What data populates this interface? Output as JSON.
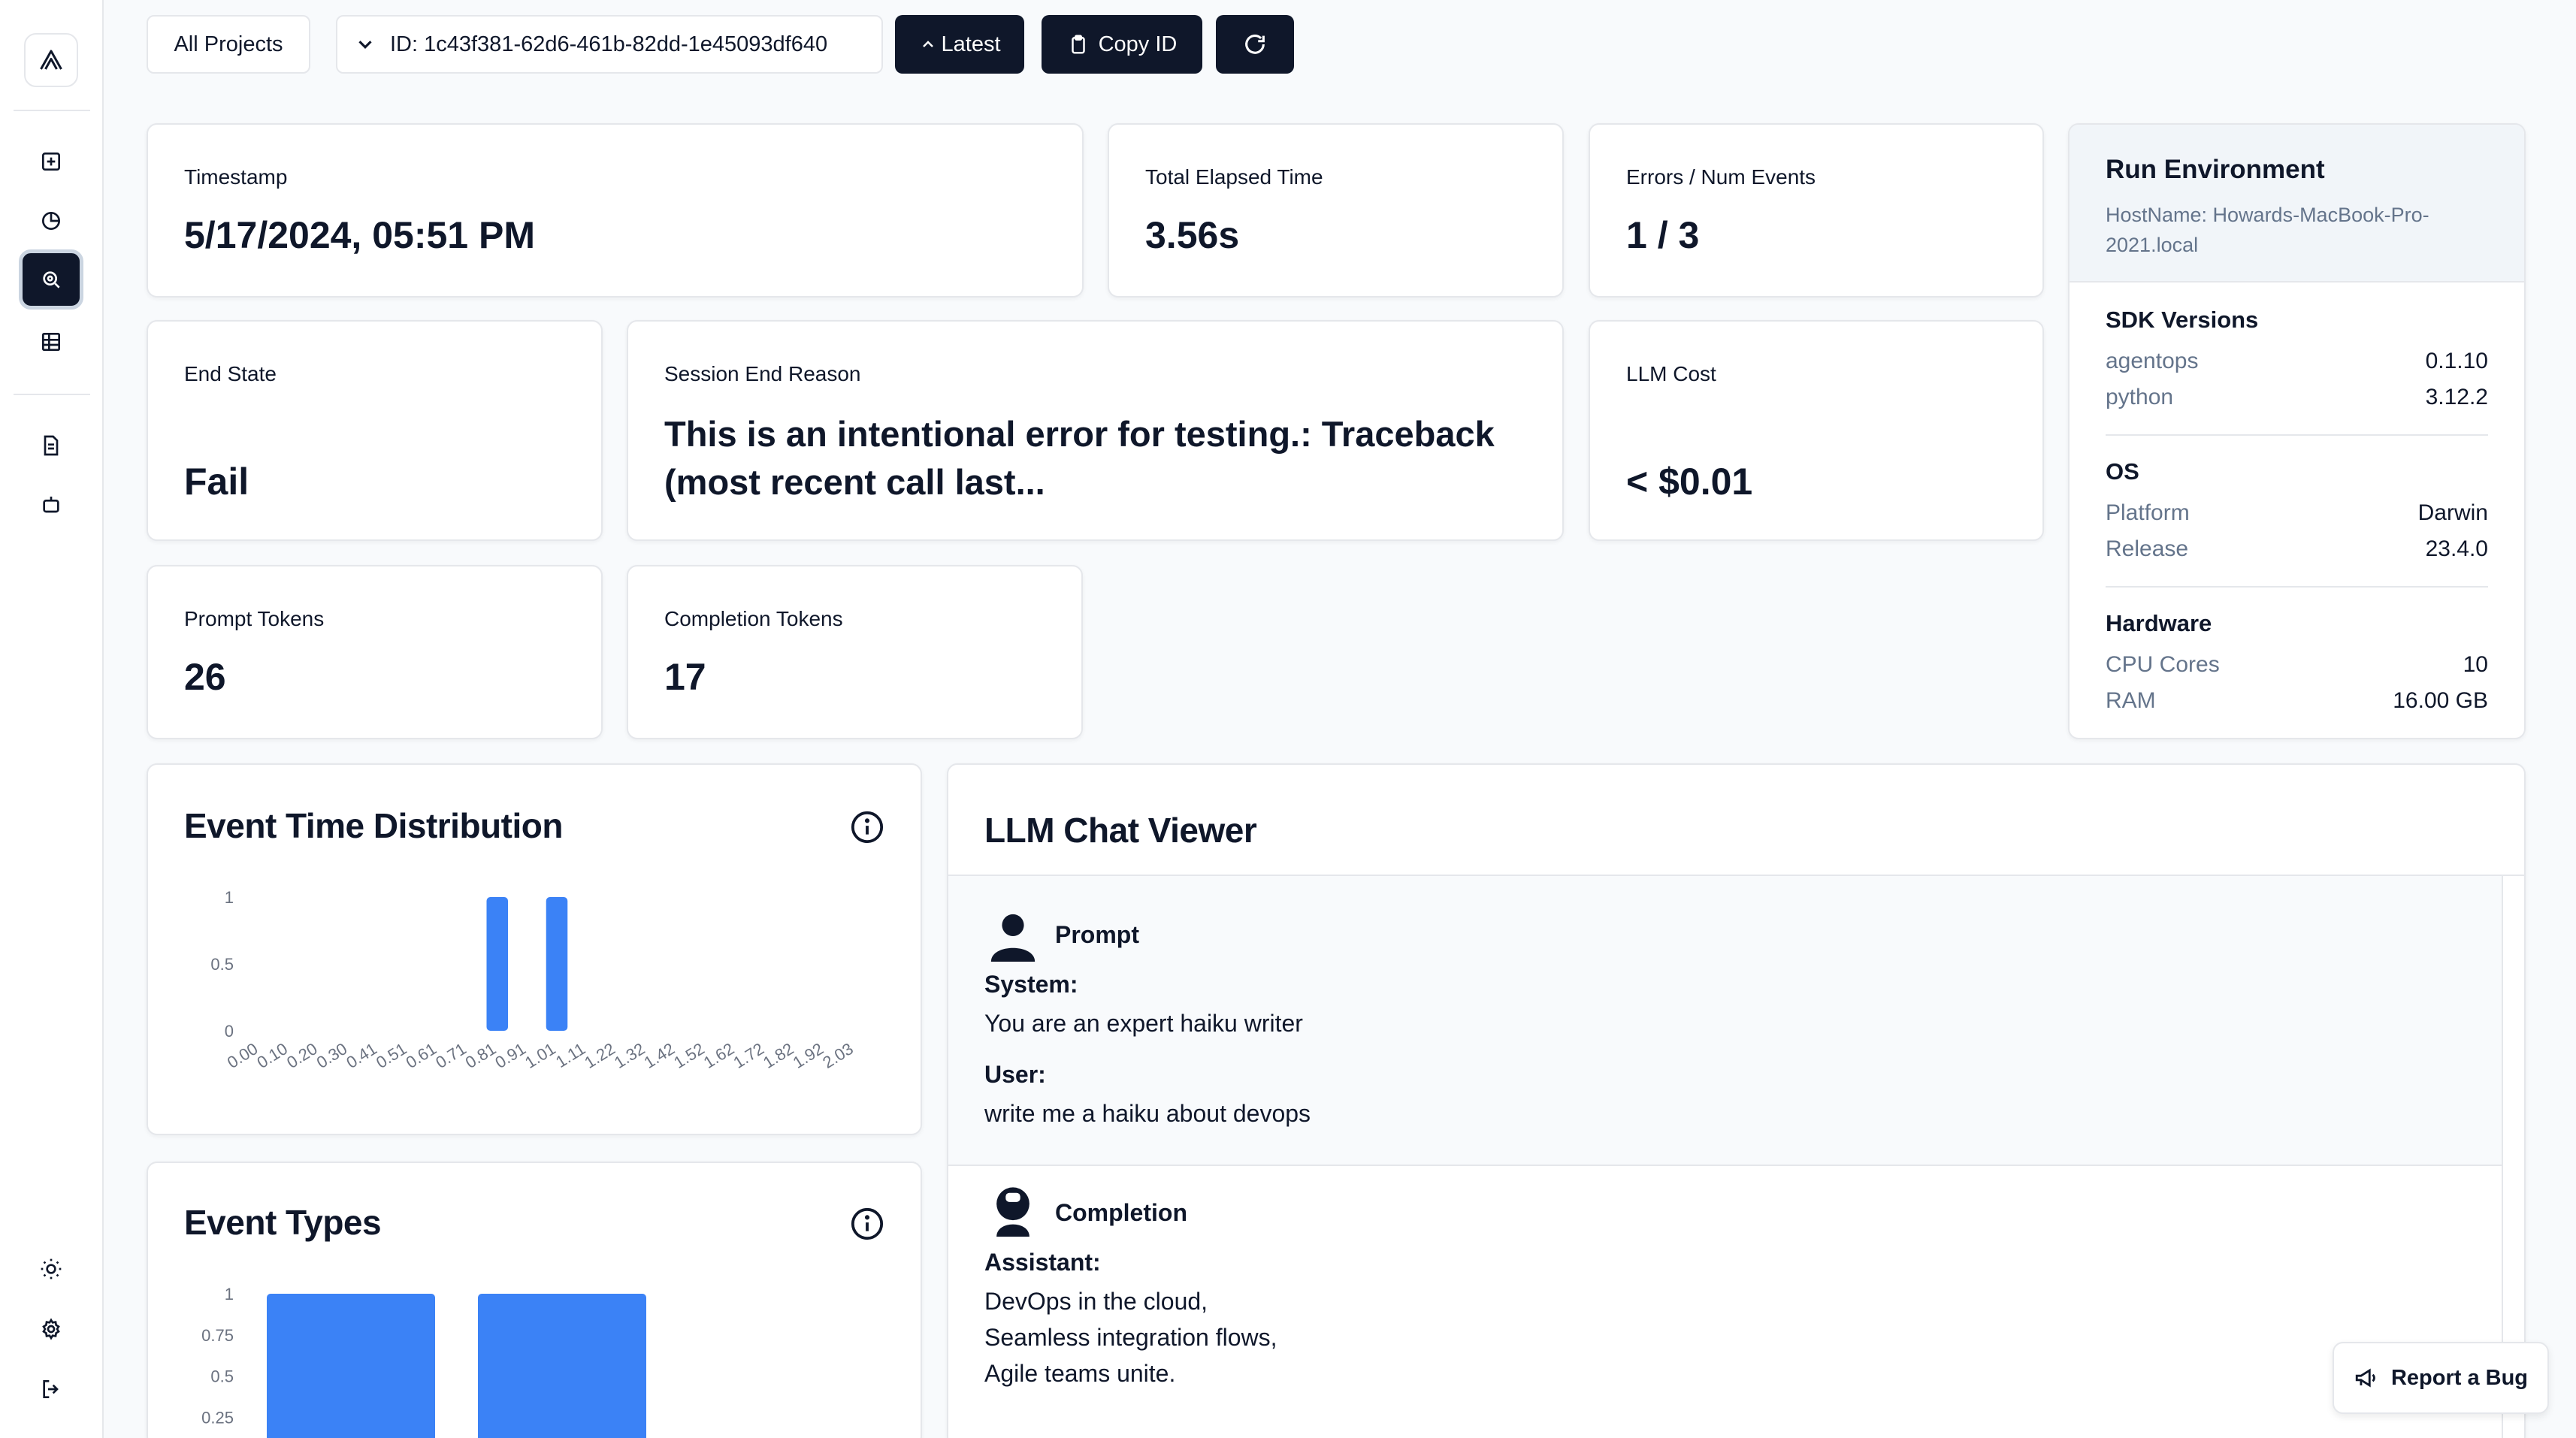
{
  "toolbar": {
    "all_projects": "All Projects",
    "session_id": "ID: 1c43f381-62d6-461b-82dd-1e45093df640",
    "latest": "Latest",
    "copy_id": "Copy ID"
  },
  "stats": {
    "timestamp_label": "Timestamp",
    "timestamp_value": "5/17/2024, 05:51 PM",
    "elapsed_label": "Total Elapsed Time",
    "elapsed_value": "3.56s",
    "errors_label": "Errors / Num Events",
    "errors_value": "1 / 3",
    "end_state_label": "End State",
    "end_state_value": "Fail",
    "end_reason_label": "Session End Reason",
    "end_reason_value": "This is an intentional error for testing.: Traceback (most recent call last...",
    "llm_cost_label": "LLM Cost",
    "llm_cost_value": "< $0.01",
    "prompt_tokens_label": "Prompt Tokens",
    "prompt_tokens_value": "26",
    "completion_tokens_label": "Completion Tokens",
    "completion_tokens_value": "17"
  },
  "env": {
    "title": "Run Environment",
    "host": "HostName: Howards-MacBook-Pro-2021.local",
    "sdk_title": "SDK Versions",
    "sdk": [
      {
        "k": "agentops",
        "v": "0.1.10"
      },
      {
        "k": "python",
        "v": "3.12.2"
      }
    ],
    "os_title": "OS",
    "os": [
      {
        "k": "Platform",
        "v": "Darwin"
      },
      {
        "k": "Release",
        "v": "23.4.0"
      }
    ],
    "hw_title": "Hardware",
    "hw": [
      {
        "k": "CPU Cores",
        "v": "10"
      },
      {
        "k": "RAM",
        "v": "16.00 GB"
      }
    ]
  },
  "event_time": {
    "title": "Event Time Distribution"
  },
  "event_types": {
    "title": "Event Types"
  },
  "chat": {
    "title": "LLM Chat Viewer",
    "prompt_label": "Prompt",
    "system_role": "System:",
    "system_msg": "You are an expert haiku writer",
    "user_role": "User:",
    "user_msg": "write me a haiku about devops",
    "completion_label": "Completion",
    "assistant_role": "Assistant:",
    "assistant_lines": [
      "DevOps in the cloud,",
      "Seamless integration flows,",
      "Agile teams unite."
    ]
  },
  "report_bug": "Report a Bug",
  "colors": {
    "bar": "#3b82f6",
    "dark": "#0f172a",
    "muted": "#64748b"
  },
  "chart_data": [
    {
      "type": "bar",
      "title": "Event Time Distribution",
      "categories": [
        "0.00",
        "0.10",
        "0.20",
        "0.30",
        "0.41",
        "0.51",
        "0.61",
        "0.71",
        "0.81",
        "0.91",
        "1.01",
        "1.11",
        "1.22",
        "1.32",
        "1.42",
        "1.52",
        "1.62",
        "1.72",
        "1.82",
        "1.92",
        "2.03"
      ],
      "values": [
        0,
        0,
        0,
        0,
        0,
        0,
        0,
        0,
        1,
        0,
        1,
        0,
        0,
        0,
        0,
        0,
        0,
        0,
        0,
        0,
        0
      ],
      "yticks": [
        "0",
        "0.5",
        "1"
      ],
      "ylim": [
        0,
        1
      ],
      "grid": false
    },
    {
      "type": "bar",
      "title": "Event Types",
      "values": [
        1,
        1
      ],
      "yticks": [
        "1",
        "0.75",
        "0.5",
        "0.25"
      ],
      "ylim": [
        0,
        1
      ],
      "grid": false
    }
  ]
}
